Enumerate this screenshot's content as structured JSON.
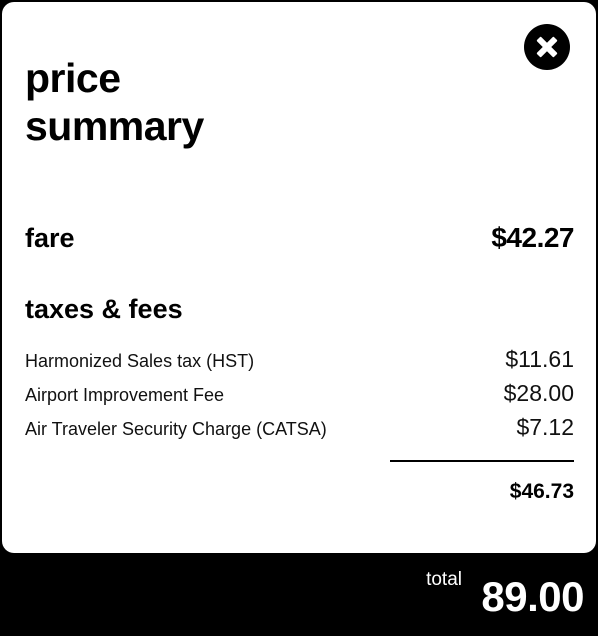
{
  "modal": {
    "title_line1": "price",
    "title_line2": "summary",
    "close_icon": "close-icon"
  },
  "fare": {
    "label": "fare",
    "amount": "$42.27"
  },
  "taxes_fees": {
    "title": "taxes & fees",
    "items": [
      {
        "label": "Harmonized Sales tax (HST)",
        "amount": "$11.61"
      },
      {
        "label": "Airport Improvement Fee",
        "amount": "$28.00"
      },
      {
        "label": "Air Traveler Security Charge (CATSA)",
        "amount": "$7.12"
      }
    ],
    "subtotal": "$46.73"
  },
  "footer": {
    "total_label": "total",
    "total_value": "89.00"
  },
  "colors": {
    "background": "#000000",
    "card": "#ffffff",
    "text": "#000000"
  }
}
